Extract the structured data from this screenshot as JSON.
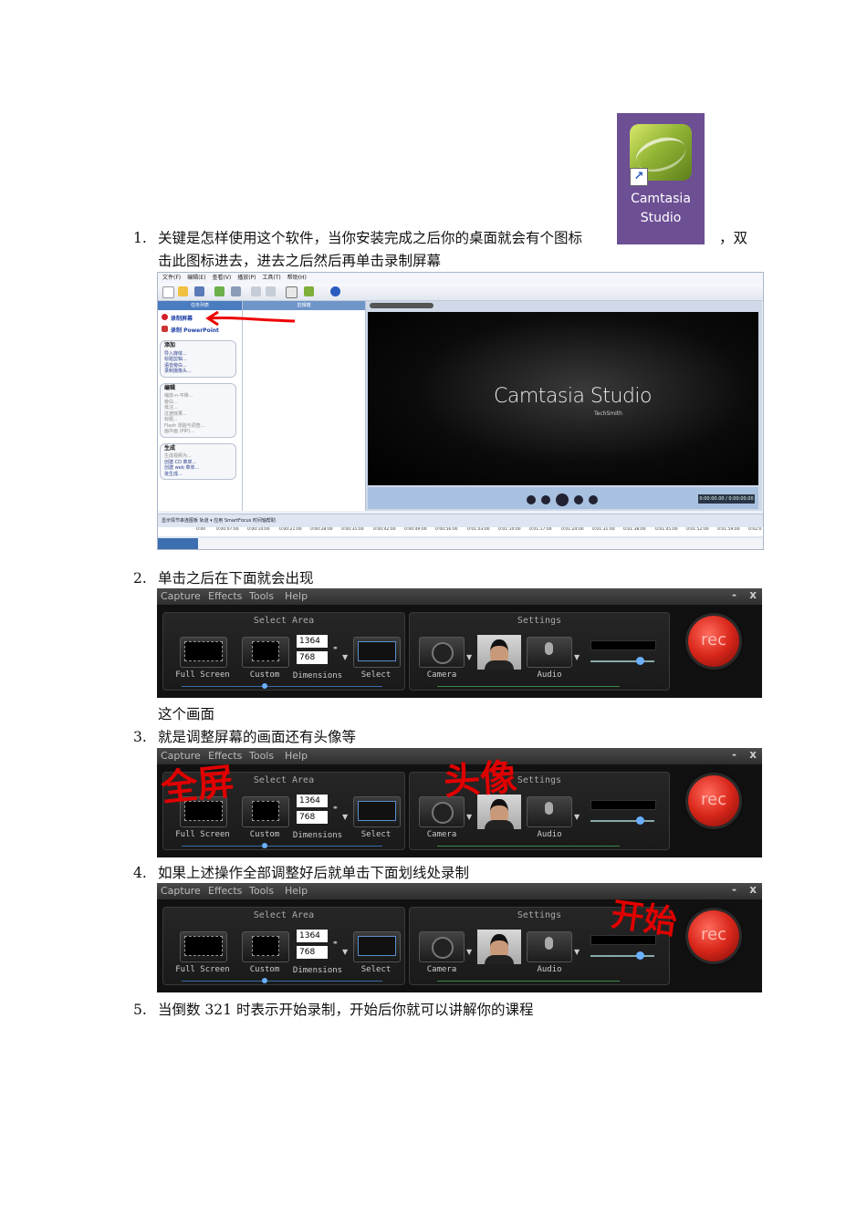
{
  "desktop_icon": {
    "label_line1": "Camtasia",
    "label_line2": "Studio",
    "shortcut_glyph": "↗"
  },
  "steps": [
    {
      "num": "1.",
      "text_a": "关键是怎样使用这个软件，当你安装完成之后你的桌面就会有个图标",
      "text_b": "，双",
      "text_c": "击此图标进去，进去之后然后再单击录制屏幕"
    },
    {
      "num": "2.",
      "text": "单击之后在下面就会出现",
      "text_after": "这个画面"
    },
    {
      "num": "3.",
      "text": "就是调整屏幕的画面还有头像等"
    },
    {
      "num": "4.",
      "text": "如果上述操作全部调整好后就单击下面划线处录制"
    },
    {
      "num": "5.",
      "text": "当倒数 321 时表示开始录制，开始后你就可以讲解你的课程"
    }
  ],
  "camtasia": {
    "menu": [
      "文件(F)",
      "编辑(E)",
      "查看(V)",
      "播放(P)",
      "工具(T)",
      "帮助(H)"
    ],
    "task_header": "任务列表",
    "task_items": [
      "录制屏幕",
      "录制 PowerPoint"
    ],
    "groups": [
      {
        "title": "添加",
        "items": [
          "导入媒体...",
          "标题剪辑...",
          "语音旁白...",
          "录制摄像头..."
        ],
        "dim": false
      },
      {
        "title": "编辑",
        "items": [
          "缩放-n-平移...",
          "旁白...",
          "批注...",
          "过渡效果...",
          "标题...",
          "Flash 测验与调查...",
          "画中画 (PIP)..."
        ],
        "dim": true
      },
      {
        "title": "生成",
        "items": [
          "生成视频为...",
          "创建 CD 菜单...",
          "创建 web 菜单...",
          "批生成..."
        ],
        "dim": false
      }
    ],
    "clipbin_header": "剪辑箱",
    "brand": "Camtasia Studio",
    "techsmith": "TechSmith",
    "time": "0:00:00.00 / 0:00:00.00",
    "timeline_bar": "显示情节串连图板    轨道 ▾                      应用 SmartFocus    时间轴帮助",
    "ruler": [
      "0:00",
      "0:00:07:00",
      "0:00:14:00",
      "0:00:21:00",
      "0:00:28:00",
      "0:00:35:00",
      "0:00:42:00",
      "0:00:49:00",
      "0:00:56:00",
      "0:01:03:00",
      "0:01:10:00",
      "0:01:17:00",
      "0:01:24:00",
      "0:01:31:00",
      "0:01:38:00",
      "0:01:45:00",
      "0:01:52:00",
      "0:01:59:00",
      "0:02:0"
    ]
  },
  "recorder": {
    "menu": [
      "Capture",
      "Effects",
      "Tools",
      "Help"
    ],
    "minimize": "-",
    "close": "x",
    "select_area_title": "Select Area",
    "settings_title": "Settings",
    "full_screen": "Full Screen",
    "custom": "Custom",
    "width": "1364",
    "height": "768",
    "dimensions": "Dimensions",
    "select": "Select",
    "camera": "Camera",
    "audio": "Audio",
    "rec": "rec"
  },
  "annotations": {
    "fullscreen": "全屏",
    "camera": "头像",
    "start": "开始"
  }
}
